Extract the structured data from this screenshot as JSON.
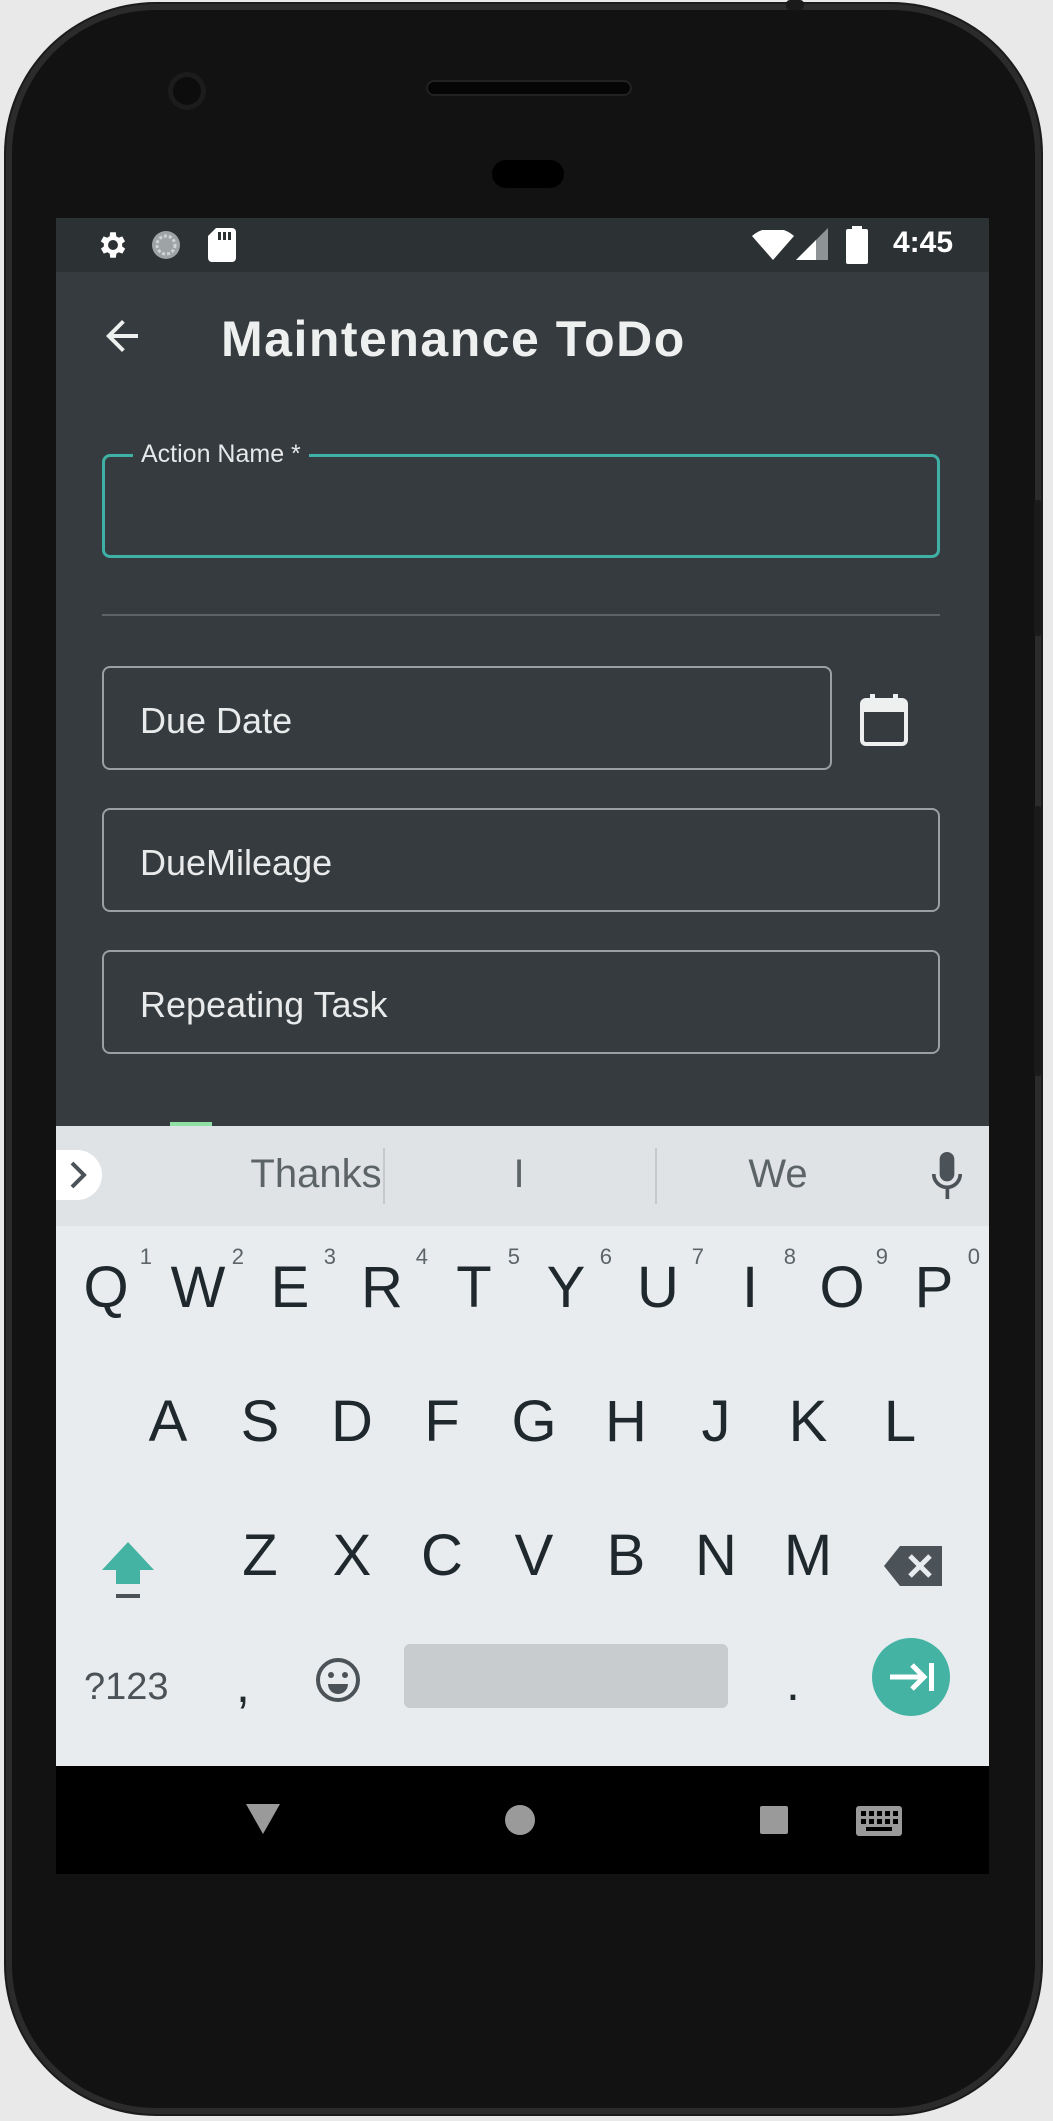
{
  "status_bar": {
    "time": "4:45",
    "left_icons": [
      "settings-icon",
      "sync-icon",
      "sd-card-icon"
    ],
    "right_icons": [
      "wifi-icon",
      "signal-icon",
      "battery-icon"
    ]
  },
  "app_bar": {
    "back_icon": "arrow-back-icon",
    "title": "Maintenance ToDo"
  },
  "form": {
    "action_name": {
      "label": "Action Name *",
      "value": ""
    },
    "due_date": {
      "placeholder": "Due Date",
      "icon": "calendar-icon"
    },
    "due_mileage": {
      "placeholder": "DueMileage"
    },
    "repeating_task": {
      "placeholder": "Repeating Task"
    }
  },
  "keyboard": {
    "suggestions": [
      "Thanks",
      "I",
      "We"
    ],
    "row1": [
      "Q",
      "W",
      "E",
      "R",
      "T",
      "Y",
      "U",
      "I",
      "O",
      "P"
    ],
    "row1_hints": [
      "1",
      "2",
      "3",
      "4",
      "5",
      "6",
      "7",
      "8",
      "9",
      "0"
    ],
    "row2": [
      "A",
      "S",
      "D",
      "F",
      "G",
      "H",
      "J",
      "K",
      "L"
    ],
    "row3": [
      "Z",
      "X",
      "C",
      "V",
      "B",
      "N",
      "M"
    ],
    "symbols_key": "?123",
    "comma_key": ",",
    "period_key": ".",
    "accent_color": "#44b3a4"
  },
  "nav_bar": {
    "icons": [
      "back-triangle-icon",
      "home-circle-icon",
      "recents-square-icon",
      "keyboard-icon"
    ]
  }
}
